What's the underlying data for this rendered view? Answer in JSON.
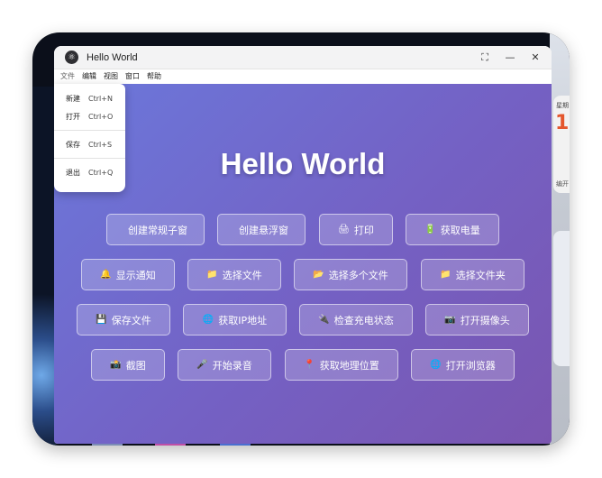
{
  "window": {
    "title": "Hello World",
    "icon": "electron-icon",
    "controls": {
      "restore": "⛶",
      "minimize": "—",
      "close": "✕"
    }
  },
  "menubar": {
    "items": [
      {
        "label": "文件"
      },
      {
        "label": "编辑"
      },
      {
        "label": "视图"
      },
      {
        "label": "窗口"
      },
      {
        "label": "帮助"
      }
    ]
  },
  "file_menu": {
    "items": [
      {
        "label": "新建",
        "shortcut": "Ctrl+N"
      },
      {
        "label": "打开",
        "shortcut": "Ctrl+O"
      },
      {
        "label": "保存",
        "shortcut": "Ctrl+S"
      },
      {
        "label": "退出",
        "shortcut": "Ctrl+Q"
      }
    ]
  },
  "main": {
    "heading": "Hello World",
    "buttons": [
      {
        "label": "创建常规子窗",
        "icon": ""
      },
      {
        "label": "创建悬浮窗",
        "icon": ""
      },
      {
        "label": "打印",
        "icon": "🖨"
      },
      {
        "label": "获取电量",
        "icon": "🔋"
      },
      {
        "label": "显示通知",
        "icon": "🔔"
      },
      {
        "label": "选择文件",
        "icon": "📁"
      },
      {
        "label": "选择多个文件",
        "icon": "📂"
      },
      {
        "label": "选择文件夹",
        "icon": "📁"
      },
      {
        "label": "保存文件",
        "icon": "💾"
      },
      {
        "label": "获取IP地址",
        "icon": "🌐"
      },
      {
        "label": "检查充电状态",
        "icon": "🔌"
      },
      {
        "label": "打开摄像头",
        "icon": "📷"
      },
      {
        "label": "截图",
        "icon": "📸"
      },
      {
        "label": "开始录音",
        "icon": "🎤"
      },
      {
        "label": "获取地理位置",
        "icon": "📍"
      },
      {
        "label": "打开浏览器",
        "icon": "🌐"
      }
    ]
  },
  "desktop": {
    "widget_label": "星期",
    "widget_number": "1",
    "widget_footer": "编开"
  },
  "colors": {
    "gradient_start": "#6b78db",
    "gradient_end": "#7a55b0",
    "widget_accent": "#e4572e"
  }
}
